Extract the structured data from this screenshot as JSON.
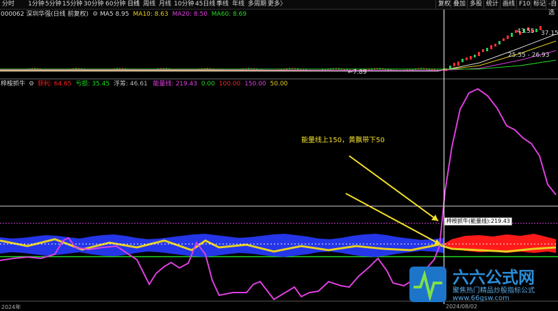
{
  "toolbar": {
    "periods": [
      "分时",
      "1分钟",
      "5分钟",
      "15分钟",
      "30分钟",
      "60分钟",
      "日线",
      "周线",
      "月线",
      "10分钟",
      "45日线",
      "季线",
      "年线",
      "多周期",
      "更多"
    ],
    "active_period": "日线",
    "more_arrow": "〉",
    "right_buttons": [
      "复权",
      "叠加",
      "多股",
      "统计",
      "画线",
      "F10",
      "标记",
      "-自选"
    ]
  },
  "main_legend": {
    "code_name": "000062 深圳华强(日线 前复权)",
    "ma5_label": "MA5",
    "ma5_value": "8.95",
    "ma10_label": "MA10:",
    "ma10_value": "8.63",
    "ma20_label": "MA20:",
    "ma20_value": "8.50",
    "ma60_label": "MA60:",
    "ma60_value": "8.69"
  },
  "price_labels": {
    "p1": "43.55",
    "p2": "37.15",
    "p3": "25.55 - 26.93",
    "p4": "←7.89"
  },
  "indicator_legend": {
    "name": "梓桉抓牛",
    "huoli_label": "获利:",
    "huoli_value": "64.65",
    "haosun_label": "亏损:",
    "haosun_value": "35.45",
    "fushou_label": "浮筹:",
    "fushou_value": "46.61",
    "energy_label": "能量线:",
    "energy_value": "219.43",
    "l0": "0.00",
    "l100": "100.00",
    "l150": "150.00",
    "l50": "50.00"
  },
  "annotation": "能量线上150，黄飘带下50",
  "tooltip": "梓桉抓牛(能量线):219.43",
  "dates": {
    "d1": "2024年",
    "d2": "2024/08/02"
  },
  "logo": {
    "title": "六六公式网",
    "subtitle": "聚焦热门精品炒股指标公式",
    "url": "www.66gsw.com"
  },
  "watermark": "六六公式网",
  "colors": {
    "energy": "#e040e0",
    "band_blue": "#2436e8",
    "band_red": "#ff1a1a",
    "ribbon_yellow": "#e8d020",
    "green_line": "#22dd22"
  }
}
